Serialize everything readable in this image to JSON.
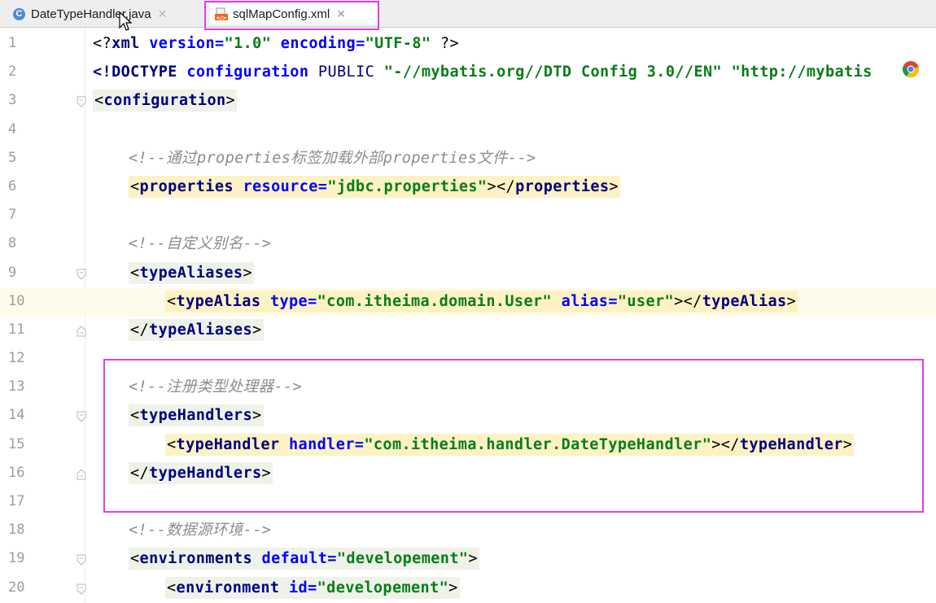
{
  "tabs": [
    {
      "label": "DateTypeHandler.java",
      "icon": "java-class-icon",
      "active": false
    },
    {
      "label": "sqlMapConfig.xml",
      "icon": "xml-file-icon",
      "active": true
    }
  ],
  "colors": {
    "tag": "#000080",
    "attribute": "#0000ff",
    "value": "#067d17",
    "comment": "#8c8c8c",
    "highlight_border": "#e040e0",
    "current_line": "#fffbea"
  },
  "lines": [
    {
      "n": "1",
      "indent": 0,
      "fold": "",
      "bg": "",
      "tokens": [
        [
          "br",
          "<?"
        ],
        [
          "tn",
          "xml "
        ],
        [
          "an",
          "version="
        ],
        [
          "av",
          "\"1.0\""
        ],
        [
          "an",
          " encoding="
        ],
        [
          "av",
          "\"UTF-8\""
        ],
        [
          "br",
          " ?>"
        ]
      ]
    },
    {
      "n": "2",
      "indent": 0,
      "fold": "",
      "bg": "",
      "tokens": [
        [
          "tn",
          "<!DOCTYPE "
        ],
        [
          "an",
          "configuration "
        ],
        [
          "b",
          "PUBLIC "
        ],
        [
          "av",
          "\"-//mybatis.org//DTD Config 3.0//EN\" "
        ],
        [
          "av",
          "\"http://mybatis"
        ]
      ]
    },
    {
      "n": "3",
      "indent": 0,
      "fold": "open",
      "bg": "tag2",
      "tokens": [
        [
          "br",
          "<"
        ],
        [
          "tn",
          "configuration"
        ],
        [
          "br",
          ">"
        ]
      ]
    },
    {
      "n": "4",
      "indent": 0,
      "fold": "",
      "bg": "",
      "tokens": []
    },
    {
      "n": "5",
      "indent": 1,
      "fold": "",
      "bg": "",
      "tokens": [
        [
          "cm",
          "<!--通过properties标签加载外部properties文件-->"
        ]
      ]
    },
    {
      "n": "6",
      "indent": 1,
      "fold": "",
      "bg": "tag",
      "tokens": [
        [
          "br",
          "<"
        ],
        [
          "tn",
          "properties "
        ],
        [
          "an",
          "resource="
        ],
        [
          "av",
          "\"jdbc.properties\""
        ],
        [
          "br",
          "></"
        ],
        [
          "tn",
          "properties"
        ],
        [
          "br",
          ">"
        ]
      ]
    },
    {
      "n": "7",
      "indent": 0,
      "fold": "",
      "bg": "",
      "tokens": []
    },
    {
      "n": "8",
      "indent": 1,
      "fold": "",
      "bg": "",
      "tokens": [
        [
          "cm",
          "<!--自定义别名-->"
        ]
      ]
    },
    {
      "n": "9",
      "indent": 1,
      "fold": "open",
      "bg": "tag2",
      "tokens": [
        [
          "br",
          "<"
        ],
        [
          "tn",
          "typeAliases"
        ],
        [
          "br",
          ">"
        ]
      ]
    },
    {
      "n": "10",
      "indent": 2,
      "fold": "",
      "bg": "tag",
      "current": true,
      "tokens": [
        [
          "br",
          "<"
        ],
        [
          "tn",
          "typeAlias "
        ],
        [
          "an",
          "type="
        ],
        [
          "av",
          "\"com.itheima.domain.User\""
        ],
        [
          "an",
          " alias="
        ],
        [
          "av",
          "\"user\""
        ],
        [
          "br",
          "></"
        ],
        [
          "tn",
          "typeAlias"
        ],
        [
          "br",
          ">"
        ]
      ]
    },
    {
      "n": "11",
      "indent": 1,
      "fold": "close",
      "bg": "tag2",
      "tokens": [
        [
          "br",
          "</"
        ],
        [
          "tn",
          "typeAliases"
        ],
        [
          "br",
          ">"
        ]
      ]
    },
    {
      "n": "12",
      "indent": 0,
      "fold": "",
      "bg": "",
      "tokens": []
    },
    {
      "n": "13",
      "indent": 1,
      "fold": "",
      "bg": "",
      "tokens": [
        [
          "cm",
          "<!--注册类型处理器-->"
        ]
      ]
    },
    {
      "n": "14",
      "indent": 1,
      "fold": "open",
      "bg": "tag2",
      "tokens": [
        [
          "br",
          "<"
        ],
        [
          "tn",
          "typeHandlers"
        ],
        [
          "br",
          ">"
        ]
      ]
    },
    {
      "n": "15",
      "indent": 2,
      "fold": "",
      "bg": "tag",
      "tokens": [
        [
          "br",
          "<"
        ],
        [
          "tn",
          "typeHandler "
        ],
        [
          "an",
          "handler="
        ],
        [
          "av",
          "\"com.itheima.handler.DateTypeHandler\""
        ],
        [
          "br",
          "></"
        ],
        [
          "tn",
          "typeHandler"
        ],
        [
          "br",
          ">"
        ]
      ]
    },
    {
      "n": "16",
      "indent": 1,
      "fold": "close",
      "bg": "tag2",
      "tokens": [
        [
          "br",
          "</"
        ],
        [
          "tn",
          "typeHandlers"
        ],
        [
          "br",
          ">"
        ]
      ]
    },
    {
      "n": "17",
      "indent": 0,
      "fold": "",
      "bg": "",
      "tokens": []
    },
    {
      "n": "18",
      "indent": 1,
      "fold": "",
      "bg": "",
      "tokens": [
        [
          "cm",
          "<!--数据源环境-->"
        ]
      ]
    },
    {
      "n": "19",
      "indent": 1,
      "fold": "open",
      "bg": "tag2",
      "tokens": [
        [
          "br",
          "<"
        ],
        [
          "tn",
          "environments "
        ],
        [
          "an",
          "default="
        ],
        [
          "av",
          "\"developement\""
        ],
        [
          "br",
          ">"
        ]
      ]
    },
    {
      "n": "20",
      "indent": 2,
      "fold": "open",
      "bg": "tag2",
      "tokens": [
        [
          "br",
          "<"
        ],
        [
          "tn",
          "environment "
        ],
        [
          "an",
          "id="
        ],
        [
          "av",
          "\"developement\""
        ],
        [
          "br",
          ">"
        ]
      ]
    }
  ]
}
